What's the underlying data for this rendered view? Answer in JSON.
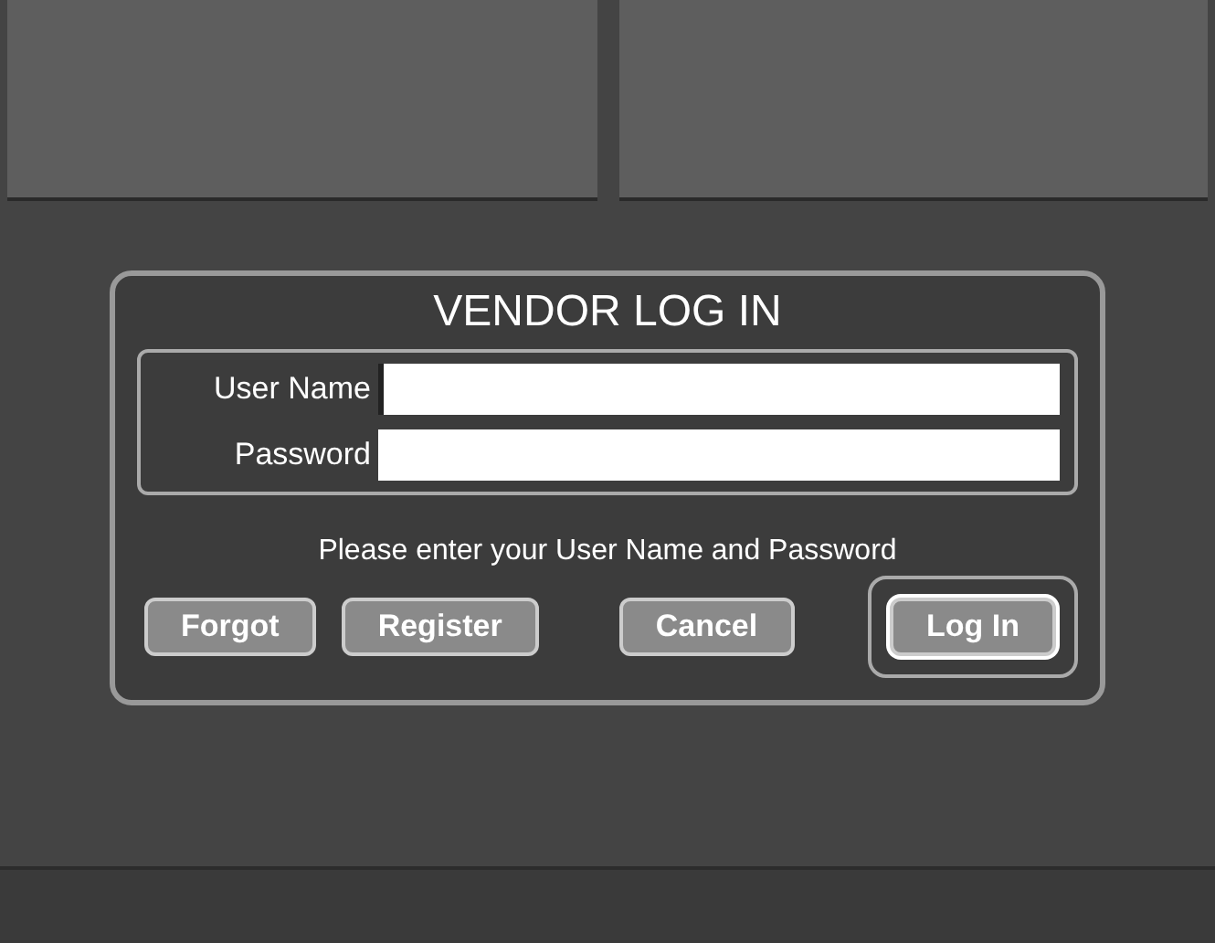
{
  "dialog": {
    "title": "VENDOR LOG IN",
    "fields": [
      {
        "label": "User Name",
        "focused": true
      },
      {
        "label": "Password",
        "focused": false
      }
    ],
    "message": "Please enter your User Name and Password",
    "buttons": [
      {
        "label": "Forgot",
        "selected": false
      },
      {
        "label": "Register",
        "selected": false
      },
      {
        "label": "Cancel",
        "selected": false
      },
      {
        "label": "Log In",
        "selected": true
      }
    ]
  }
}
